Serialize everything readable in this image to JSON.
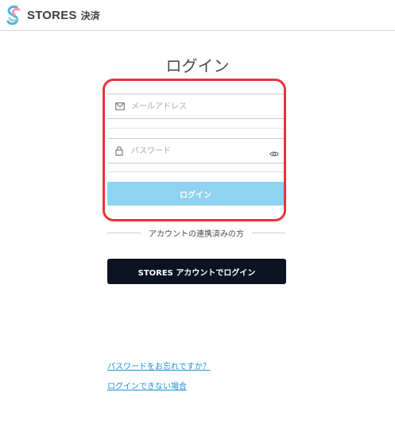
{
  "header": {
    "brand": "STORES",
    "brand_sub": "決済",
    "logo_icon": "stores-logo-icon"
  },
  "title": "ログイン",
  "form": {
    "email": {
      "placeholder": "メールアドレス",
      "value": "",
      "icon": "mail-icon"
    },
    "password": {
      "placeholder": "パスワード",
      "value": "",
      "icon": "lock-icon",
      "toggle_icon": "eye-icon"
    },
    "login_label": "ログイン"
  },
  "separator": {
    "text": "アカウントの連携済みの方"
  },
  "stores_login_label": "STORES アカウントでログイン",
  "links": {
    "forgot_password": "パスワードをお忘れですか？",
    "cannot_login": "ログインできない場合"
  },
  "colors": {
    "highlight": "#e8333a",
    "login_button": "#8fd3f2",
    "stores_button": "#0d1223",
    "link": "#1f8fd1"
  }
}
